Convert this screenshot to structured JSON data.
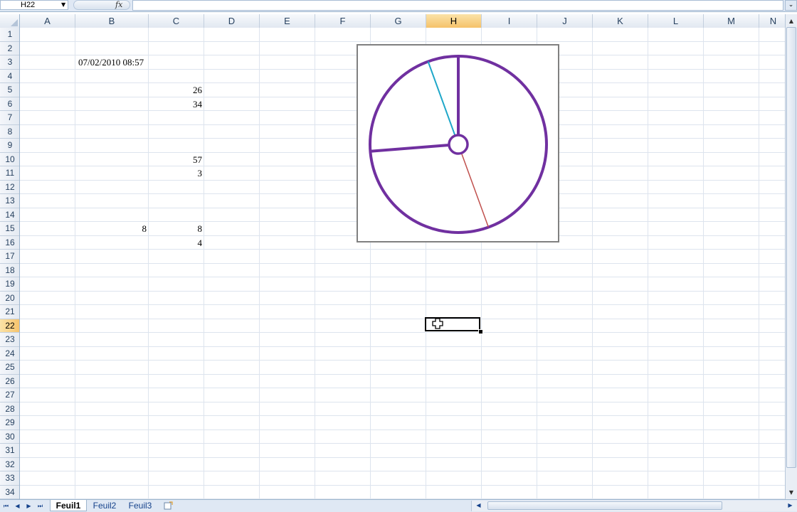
{
  "formula_bar": {
    "name_box": "H22",
    "fx_label": "fx",
    "formula_value": ""
  },
  "columns": [
    "A",
    "B",
    "C",
    "D",
    "E",
    "F",
    "G",
    "H",
    "I",
    "J",
    "K",
    "L",
    "M",
    "N"
  ],
  "active_column": "H",
  "rows": [
    "1",
    "2",
    "3",
    "4",
    "5",
    "6",
    "7",
    "8",
    "9",
    "10",
    "11",
    "12",
    "13",
    "14",
    "15",
    "16",
    "17",
    "18",
    "19",
    "20",
    "21",
    "22",
    "23",
    "24",
    "25",
    "26",
    "27",
    "28",
    "29",
    "30",
    "31",
    "32",
    "33",
    "34"
  ],
  "active_row": "22",
  "cells": {
    "B3": "07/02/2010 08:57",
    "C5": "26",
    "C6": "34",
    "C10": "57",
    "C11": "3",
    "B15": "8",
    "C15": "8",
    "C16": "4"
  },
  "clock_chart": {
    "hour": 8,
    "minute": 57,
    "second": 26,
    "colors": {
      "dial": "#7030a0",
      "minute_hand": "#7030a0",
      "hour_hand": "#7030a0",
      "second_hand": "#c0504d",
      "aux_hand": "#1fa7c9"
    }
  },
  "sheets": {
    "tabs": [
      "Feuil1",
      "Feuil2",
      "Feuil3"
    ],
    "active": "Feuil1"
  },
  "icons": {
    "name_box_dropdown": "chevron-down-icon",
    "cell_cursor": "plus-cursor-icon",
    "new_sheet": "insert-sheet-icon"
  }
}
